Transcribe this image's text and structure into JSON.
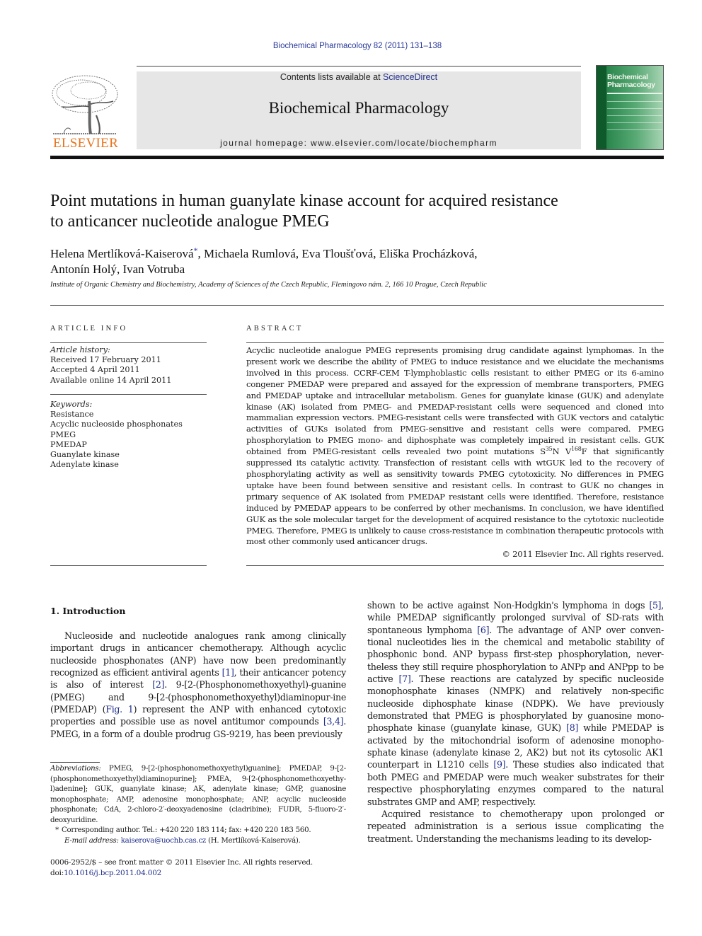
{
  "header": {
    "running_head": "Biochemical Pharmacology 82 (2011) 131–138",
    "contents_prefix": "Contents lists available at ",
    "contents_link": "ScienceDirect",
    "journal_title": "Biochemical Pharmacology",
    "homepage": "journal homepage: www.elsevier.com/locate/biochempharm",
    "publisher_logo_text": "ELSEVIER",
    "cover_title_line1": "Biochemical",
    "cover_title_line2": "Pharmacology",
    "colors": {
      "publisher_orange": "#e8731c",
      "link_blue": "#1f2d8a",
      "cover_green": "#2e8a50",
      "masthead_gray": "#e6e6e6"
    }
  },
  "article": {
    "title_line1": "Point mutations in human guanylate kinase account for acquired resistance",
    "title_line2": "to anticancer nucleotide analogue PMEG",
    "authors_line1_a": "Helena Mertlíková-Kaiserová",
    "authors_star": "*",
    "authors_line1_b": ", Michaela Rumlová, Eva Tloušťová, Eliška Procházková,",
    "authors_line2": "Antonín Holý, Ivan Votruba",
    "affiliation": "Institute of Organic Chemistry and Biochemistry, Academy of Sciences of the Czech Republic, Flemingovo nám. 2, 166 10 Prague, Czech Republic"
  },
  "article_info": {
    "label": "ARTICLE INFO",
    "history_heading": "Article history:",
    "history": [
      "Received 17 February 2011",
      "Accepted 4 April 2011",
      "Available online 14 April 2011"
    ],
    "keywords_heading": "Keywords:",
    "keywords": [
      "Resistance",
      "Acyclic nucleoside phosphonates",
      "PMEG",
      "PMEDAP",
      "Guanylate kinase",
      "Adenylate kinase"
    ]
  },
  "abstract": {
    "label": "ABSTRACT",
    "text_part1": "Acyclic nucleotide analogue PMEG represents promising drug candidate against lymphomas. In the present work we describe the ability of PMEG to induce resistance and we elucidate the mechanisms involved in this process. CCRF-CEM T-lymphoblastic cells resistant to either PMEG or its 6-amino congener PMEDAP were prepared and assayed for the expression of membrane transporters, PMEG and PMEDAP uptake and intracellular metabolism. Genes for guanylate kinase (GUK) and adenylate kinase (AK) isolated from PMEG- and PMEDAP-resistant cells were sequenced and cloned into mammalian expression vectors. PMEG-resistant cells were transfected with GUK vectors and catalytic activities of GUKs isolated from PMEG-sensitive and resistant cells were compared. PMEG phosphorylation to PMEG mono- and diphosphate was completely impaired in resistant cells. GUK obtained from PMEG-resistant cells revealed two point mutations S",
    "sup1": "35",
    "text_part2": "N V",
    "sup2": "168",
    "text_part3": "F that significantly suppressed its catalytic activity. Transfection of resistant cells with wtGUK led to the recovery of phosphorylating activity as well as sensitivity towards PMEG cytotoxicity. No differences in PMEG uptake have been found between sensitive and resistant cells. In contrast to GUK no changes in primary sequence of AK isolated from PMEDAP resistant cells were identified. Therefore, resistance induced by PMEDAP appears to be conferred by other mechanisms. In conclusion, we have identified GUK as the sole molecular target for the development of acquired resistance to the cytotoxic nucleotide PMEG. Therefore, PMEG is unlikely to cause cross-resistance in combination therapeutic protocols with most other commonly used anticancer drugs.",
    "copyright": "© 2011 Elsevier Inc. All rights reserved."
  },
  "introduction": {
    "heading": "1. Introduction",
    "left": {
      "p1_a": "Nucleoside and nucleotide analogues rank among clinically important drugs in anticancer chemotherapy. Although acyclic nucleoside phosphonates (ANP) have now been predominantly recognized as efficient antiviral agents ",
      "ref1": "[1]",
      "p1_b": ", their anticancer potency is also of interest ",
      "ref2": "[2]",
      "p1_c": ". 9-[2-(Phosphonomethoxyethyl)-guanine (PMEG) and 9-[2-(phosphonomethoxyethyl)diaminopur-ine (PMEDAP) (",
      "fig1": "Fig. 1",
      "p1_d": ") represent the ANP with enhanced cytotoxic properties and possible use as novel antitumor compounds ",
      "ref34": "[3,4]",
      "p1_e": ". PMEG, in a form of a double prodrug GS-9219, has been previously"
    },
    "right": {
      "p1_a": "shown to be active against Non-Hodgkin's lymphoma in dogs ",
      "ref5": "[5]",
      "p1_b": ", while PMEDAP significantly prolonged survival of SD-rats with spontaneous lymphoma ",
      "ref6": "[6]",
      "p1_c": ". The advantage of ANP over conven-tional nucleotides lies in the chemical and metabolic stability of phosphonic bond. ANP bypass first-step phosphorylation, never-theless they still require phosphorylation to ANPp and ANPpp to be active ",
      "ref7": "[7]",
      "p1_d": ". These reactions are catalyzed by specific nucleoside monophosphate kinases (NMPK) and relatively non-specific nucleoside diphosphate kinase (NDPK). We have previously demonstrated that PMEG is phosphorylated by guanosine mono-phosphate kinase (guanylate kinase, GUK) ",
      "ref8": "[8]",
      "p1_e": " while PMEDAP is activated by the mitochondrial isoform of adenosine monopho-sphate kinase (adenylate kinase 2, AK2) but not its cytosolic AK1 counterpart in L1210 cells ",
      "ref9": "[9]",
      "p1_f": ". These studies also indicated that both PMEG and PMEDAP were much weaker substrates for their respective phosphorylating enzymes compared to the natural substrates GMP and AMP, respectively.",
      "p2": "Acquired resistance to chemotherapy upon prolonged or repeated administration is a serious issue complicating the treatment. Understanding the mechanisms leading to its develop-"
    }
  },
  "footnotes": {
    "abbrev_label": "Abbreviations:",
    "abbrev_text": " PMEG, 9-[2-(phosphonomethoxyethyl)guanine]; PMEDAP, 9-[2-(phosphonomethoxyethyl)diaminopurine]; PMEA, 9-[2-(phosphonomethoxyethy-l)adenine]; GUK, guanylate kinase; AK, adenylate kinase; GMP, guanosine monophosphate; AMP, adenosine monophosphate; ANP, acyclic nucleoside phosphonate; CdA, 2-chloro-2′-deoxyadenosine (cladribine); FUDR, 5-fluoro-2′-deoxyuridine.",
    "star": "*",
    "corresponding": "Corresponding author. Tel.: +420 220 183 114; fax: +420 220 183 560.",
    "email_label": "E-mail address:",
    "email": "kaiserova@uochb.cas.cz",
    "email_suffix": " (H. Mertlíková-Kaiserová).",
    "front_matter": "0006-2952/$ – see front matter © 2011 Elsevier Inc. All rights reserved.",
    "doi_prefix": "doi:",
    "doi": "10.1016/j.bcp.2011.04.002"
  }
}
